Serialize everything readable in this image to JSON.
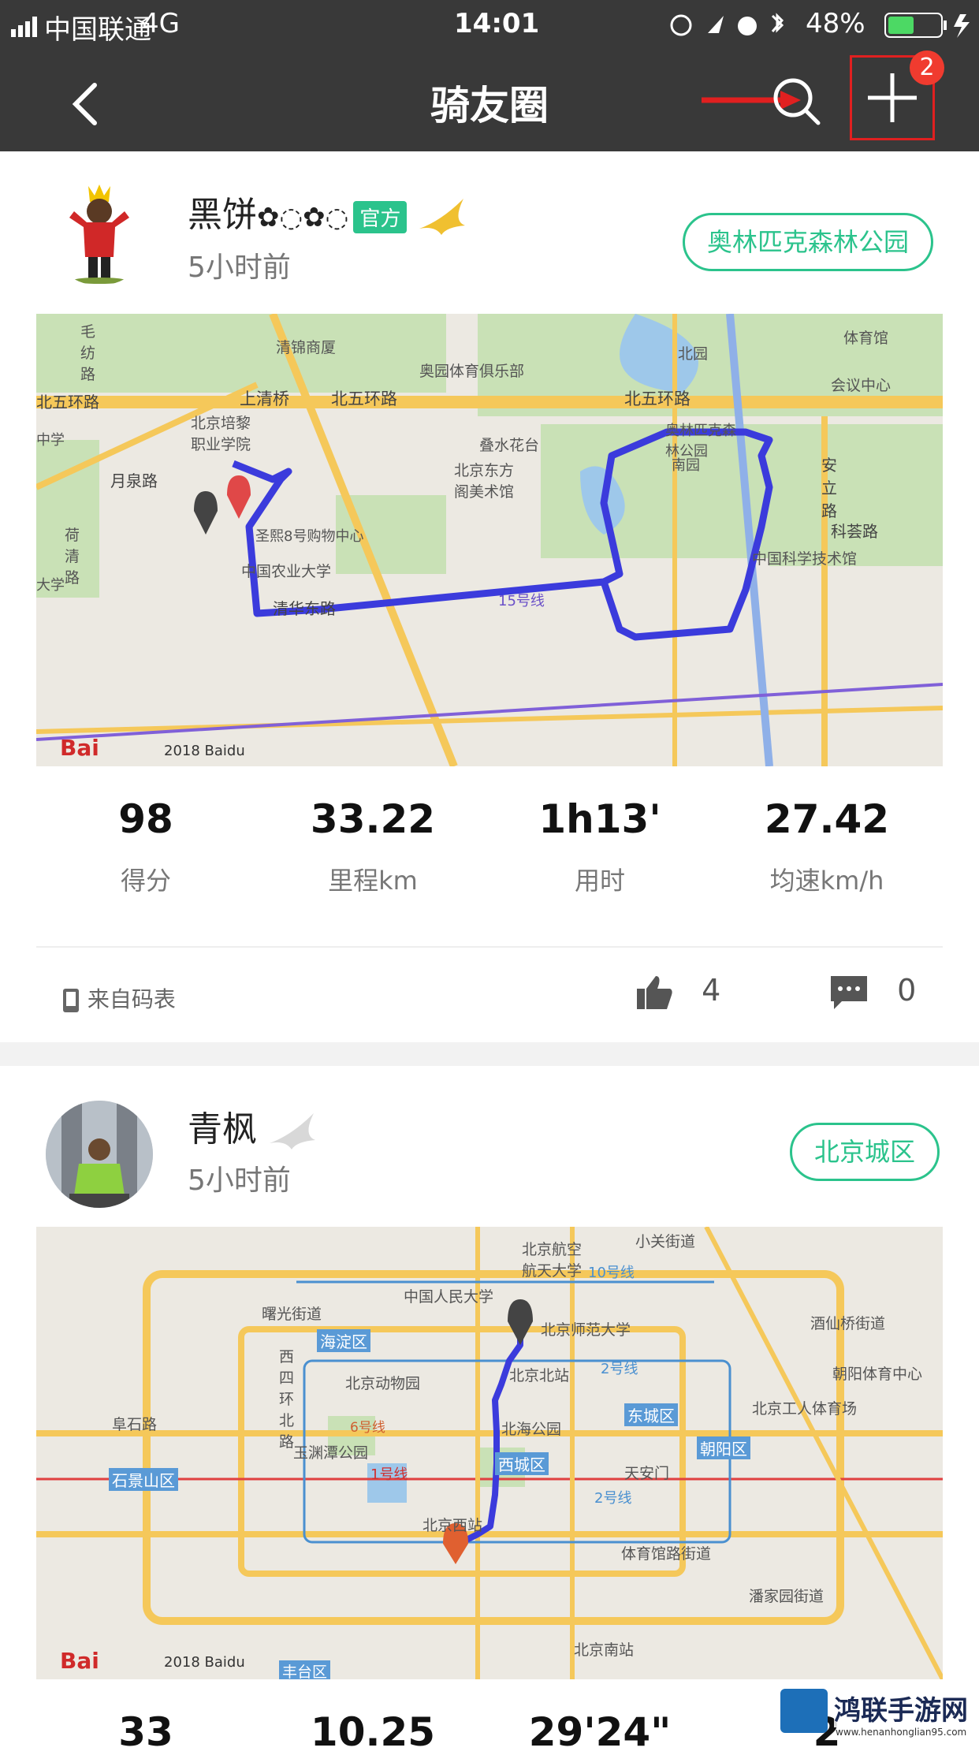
{
  "status": {
    "carrier": "中国联通",
    "network": "4G",
    "time": "14:01",
    "battery": "48%"
  },
  "nav": {
    "title": "骑友圈",
    "badge": "2"
  },
  "posts": [
    {
      "name": "黑饼",
      "emoji": "✿◌✿◌",
      "official": "官方",
      "time": "5小时前",
      "place": "奥林匹克森林公园",
      "map_labels": [
        "清锦商厦",
        "奥园体育俱乐部",
        "北园",
        "体育馆",
        "会议中心",
        "北五环路",
        "上清桥",
        "北五环路",
        "北京培黎职业学院",
        "叠水花台",
        "奥林匹克森林公园",
        "南园",
        "北京东方阁美术馆",
        "月泉路",
        "安立路",
        "科荟路",
        "圣熙8号购物中心",
        "中国农业大学",
        "中国科学技术馆",
        "清华东路",
        "15号线",
        "毛纺路",
        "北五环路",
        "中学",
        "荷清路",
        "大学",
        "2018 Baidu"
      ],
      "score": "98",
      "score_lbl": "得分",
      "dist": "33.22",
      "dist_lbl": "里程km",
      "duration": "1h13'",
      "duration_lbl": "用时",
      "speed": "27.42",
      "speed_lbl": "均速km/h",
      "source": "来自码表",
      "likes": "4",
      "comments": "0"
    },
    {
      "name": "青枫",
      "time": "5小时前",
      "place": "北京城区",
      "map_labels": [
        "北京航空航天大学",
        "中国人民大学",
        "10号线",
        "北京师范大学",
        "小关街道",
        "曙光街道",
        "海淀区",
        "北京动物园",
        "北京北站",
        "2号线",
        "东城区",
        "北京工人体育场",
        "酒仙桥街道",
        "朝阳体育中心",
        "西四环北路",
        "阜石路",
        "北海公园",
        "玉渊潭公园",
        "西城区",
        "朝阳区",
        "天安门",
        "1号线",
        "石景山区",
        "北京西站",
        "2号线",
        "体育馆路街道",
        "潘家园街道",
        "北京南站",
        "2018 Baidu",
        "丰台区",
        "6号线"
      ],
      "score": "33",
      "dist": "10.25",
      "duration": "29'24\"",
      "speed": "2"
    }
  ],
  "watermark": {
    "main": "鸿联手游网",
    "sub": "www.henanhonglian95.com"
  }
}
